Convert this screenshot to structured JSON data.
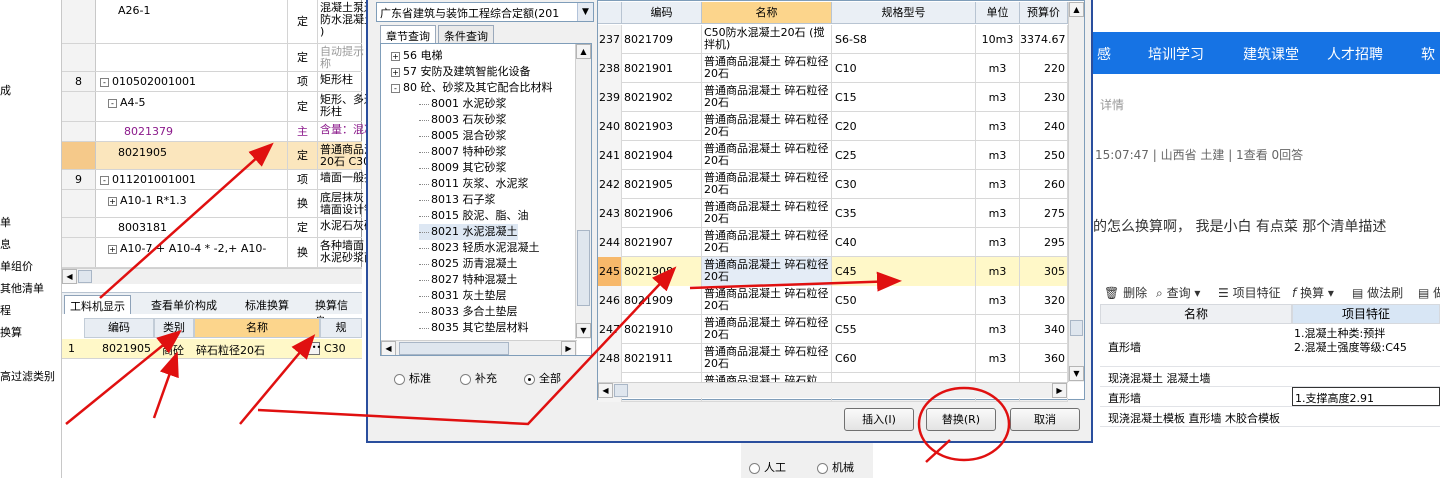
{
  "left_strip": {
    "items": [
      "成",
      "单",
      "息",
      "单组价",
      "其他清单",
      "程",
      "换算",
      "高过滤类别"
    ]
  },
  "background_grid": {
    "rows": [
      {
        "num": "",
        "code": "A26-1",
        "type": "定",
        "name": "混凝土泵送增加费 防水混凝土(计算超 )"
      },
      {
        "num": "",
        "code": "",
        "type": "定",
        "name": "自动提示：请输入 称"
      },
      {
        "num": "8",
        "code": "010502001001",
        "type": "项",
        "name": "矩形柱"
      },
      {
        "num": "",
        "code": "A4-5",
        "type": "定",
        "name": "矩形、多边形、异形 形柱"
      },
      {
        "num": "",
        "code": "8021379",
        "type": "主",
        "name": "含量：混凝土（制作"
      },
      {
        "num": "",
        "code": "8021905",
        "type": "定",
        "name": "普通商品混凝土 碎 20石 C30"
      },
      {
        "num": "9",
        "code": "011201001001",
        "type": "项",
        "name": "墙面一般抹灰"
      },
      {
        "num": "",
        "code": "A10-1 R*1.3",
        "type": "换",
        "name": "底层抹灰 各种墙面 墙面设计钉(挂)网"
      },
      {
        "num": "",
        "code": "8003181",
        "type": "定",
        "name": "水泥石灰砂浆 1:0."
      },
      {
        "num": "",
        "code": "A10-7 + A10-4 * -2,+ A10-",
        "type": "换",
        "name": "各种墙面 水泥石灰 水泥砂浆面 15+5m"
      }
    ],
    "tabs": [
      "工料机显示",
      "查看单价构成",
      "标准换算",
      "换算信息"
    ],
    "bottom_headers": [
      "编码",
      "类别",
      "名称",
      "规"
    ],
    "bottom_row": {
      "num": "1",
      "code": "8021905",
      "type": "商砼",
      "name": "碎石粒径20石",
      "spec": "C30"
    }
  },
  "dialog": {
    "book": "广东省建筑与装饰工程综合定额(201",
    "tabs": [
      "章节查询",
      "条件查询"
    ],
    "tree": [
      {
        "box": "+",
        "label": "56 电梯",
        "indent": 0
      },
      {
        "box": "+",
        "label": "57 安防及建筑智能化设备",
        "indent": 0
      },
      {
        "box": "-",
        "label": "80 砼、砂浆及其它配合比材料",
        "indent": 0
      },
      {
        "box": "",
        "label": "8001 水泥砂浆",
        "indent": 1
      },
      {
        "box": "",
        "label": "8003 石灰砂浆",
        "indent": 1
      },
      {
        "box": "",
        "label": "8005 混合砂浆",
        "indent": 1
      },
      {
        "box": "",
        "label": "8007 特种砂浆",
        "indent": 1
      },
      {
        "box": "",
        "label": "8009 其它砂浆",
        "indent": 1
      },
      {
        "box": "",
        "label": "8011 灰浆、水泥浆",
        "indent": 1
      },
      {
        "box": "",
        "label": "8013 石子浆",
        "indent": 1
      },
      {
        "box": "",
        "label": "8015 胶泥、脂、油",
        "indent": 1
      },
      {
        "box": "",
        "label": "8021 水泥混凝土",
        "indent": 1
      },
      {
        "box": "",
        "label": "8023 轻质水泥混凝土",
        "indent": 1
      },
      {
        "box": "",
        "label": "8025 沥青混凝土",
        "indent": 1
      },
      {
        "box": "",
        "label": "8027 特种混凝土",
        "indent": 1
      },
      {
        "box": "",
        "label": "8031 灰土垫层",
        "indent": 1
      },
      {
        "box": "",
        "label": "8033 多合土垫层",
        "indent": 1
      },
      {
        "box": "",
        "label": "8035 其它垫层材料",
        "indent": 1
      }
    ],
    "selected_tree_index": 11,
    "radios": [
      {
        "label": "标准",
        "checked": false
      },
      {
        "label": "补充",
        "checked": false
      },
      {
        "label": "全部",
        "checked": true
      }
    ],
    "table_headers": [
      "编码",
      "名称",
      "规格型号",
      "单位",
      "预算价"
    ],
    "rows": [
      {
        "num": "237",
        "code": "8021709",
        "name": "C50防水混凝土20石 (搅拌机)",
        "spec": "S6-S8",
        "unit": "10m3",
        "price": "3374.67"
      },
      {
        "num": "238",
        "code": "8021901",
        "name": "普通商品混凝土 碎石粒径20石",
        "spec": "C10",
        "unit": "m3",
        "price": "220"
      },
      {
        "num": "239",
        "code": "8021902",
        "name": "普通商品混凝土 碎石粒径20石",
        "spec": "C15",
        "unit": "m3",
        "price": "230"
      },
      {
        "num": "240",
        "code": "8021903",
        "name": "普通商品混凝土 碎石粒径20石",
        "spec": "C20",
        "unit": "m3",
        "price": "240"
      },
      {
        "num": "241",
        "code": "8021904",
        "name": "普通商品混凝土 碎石粒径20石",
        "spec": "C25",
        "unit": "m3",
        "price": "250"
      },
      {
        "num": "242",
        "code": "8021905",
        "name": "普通商品混凝土 碎石粒径20石",
        "spec": "C30",
        "unit": "m3",
        "price": "260"
      },
      {
        "num": "243",
        "code": "8021906",
        "name": "普通商品混凝土 碎石粒径20石",
        "spec": "C35",
        "unit": "m3",
        "price": "275"
      },
      {
        "num": "244",
        "code": "8021907",
        "name": "普通商品混凝土 碎石粒径20石",
        "spec": "C40",
        "unit": "m3",
        "price": "295"
      },
      {
        "num": "245",
        "code": "8021908",
        "name": "普通商品混凝土 碎石粒径20石",
        "spec": "C45",
        "unit": "m3",
        "price": "305"
      },
      {
        "num": "246",
        "code": "8021909",
        "name": "普通商品混凝土 碎石粒径20石",
        "spec": "C50",
        "unit": "m3",
        "price": "320"
      },
      {
        "num": "247",
        "code": "8021910",
        "name": "普通商品混凝土 碎石粒径20石",
        "spec": "C55",
        "unit": "m3",
        "price": "340"
      },
      {
        "num": "248",
        "code": "8021911",
        "name": "普通商品混凝土 碎石粒径20石",
        "spec": "C60",
        "unit": "m3",
        "price": "360"
      },
      {
        "num": "",
        "code": "",
        "name": "普通商品混凝土 碎石粒",
        "spec": "",
        "unit": "",
        "price": ""
      }
    ],
    "selected_row_index": 8,
    "buttons": {
      "insert": "插入(I)",
      "replace": "替换(R)",
      "cancel": "取消"
    },
    "bottom_radios": [
      "人工",
      "机械"
    ]
  },
  "web": {
    "nav": [
      "感",
      "培训学习",
      "建筑课堂",
      "人才招聘",
      "软"
    ],
    "subnav": "详情",
    "meta": "15:07:47  |  山西省 土建  |  1查看 0回答",
    "question": "的怎么换算啊， 我是小白 有点菜   那个清单描述",
    "toolbar": [
      "删除",
      "查询",
      "项目特征",
      "换算",
      "做法刷",
      "做"
    ],
    "table_headers": [
      "名称",
      "项目特征"
    ],
    "table_rows": [
      {
        "name": "直形墙",
        "feature": "1.混凝土种类:预拌\n2.混凝土强度等级:C45"
      },
      {
        "name": "现浇混凝土 混凝土墙",
        "feature": ""
      },
      {
        "name": "直形墙",
        "feature": "1.支撑高度2.91"
      },
      {
        "name": "现浇混凝土模板 直形墙 木胶合模板",
        "feature": ""
      }
    ]
  },
  "colors": {
    "dialog_border": "#2a4e9d",
    "header_highlight": "#fcd58c",
    "selected_row_num": "#f7b86a",
    "nav_blue": "#1673e4",
    "annotation_red": "#e01010"
  }
}
